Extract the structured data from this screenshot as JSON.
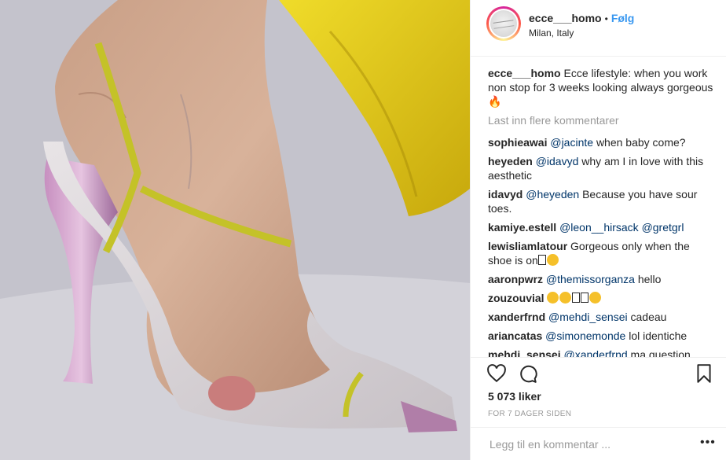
{
  "post": {
    "username": "ecce___homo",
    "dot": "•",
    "follow_label": "Følg",
    "location": "Milan, Italy"
  },
  "caption": {
    "username": "ecce___homo",
    "text": "Ecce lifestyle: when you work non stop for 3 weeks looking always gorgeous",
    "emoji": "🔥"
  },
  "load_more_label": "Last inn flere kommentarer",
  "comments": [
    {
      "user": "sophieawai",
      "mention": "@jacinte",
      "text": "when baby come?"
    },
    {
      "user": "heyeden",
      "mention": "@idavyd",
      "text": "why am I in love with this aesthetic"
    },
    {
      "user": "idavyd",
      "mention": "@heyeden",
      "text": "Because you have sour toes."
    },
    {
      "user": "kamiye.estell",
      "mention": "@leon__hirsack",
      "mention2": "@gretgrl"
    },
    {
      "user": "lewisliamlatour",
      "text": "Gorgeous only when the shoe is on"
    },
    {
      "user": "aaronpwrz",
      "mention": "@themissorganza",
      "text": "hello"
    },
    {
      "user": "zouzouvial"
    },
    {
      "user": "xanderfrnd",
      "mention": "@mehdi_sensei",
      "text": "cadeau"
    },
    {
      "user": "ariancatas",
      "mention": "@simonemonde",
      "text": "lol identiche"
    },
    {
      "user": "mehdi_sensei",
      "mention": "@xanderfrnd",
      "text": "ma question"
    }
  ],
  "likes": "5 073 liker",
  "timestamp": "FOR 7 DAGER SIDEN",
  "comment_placeholder": "Legg til en kommentar ...",
  "more_label": "•••",
  "icons": {
    "like": "heart-icon",
    "comment": "comment-icon",
    "save": "bookmark-icon"
  }
}
